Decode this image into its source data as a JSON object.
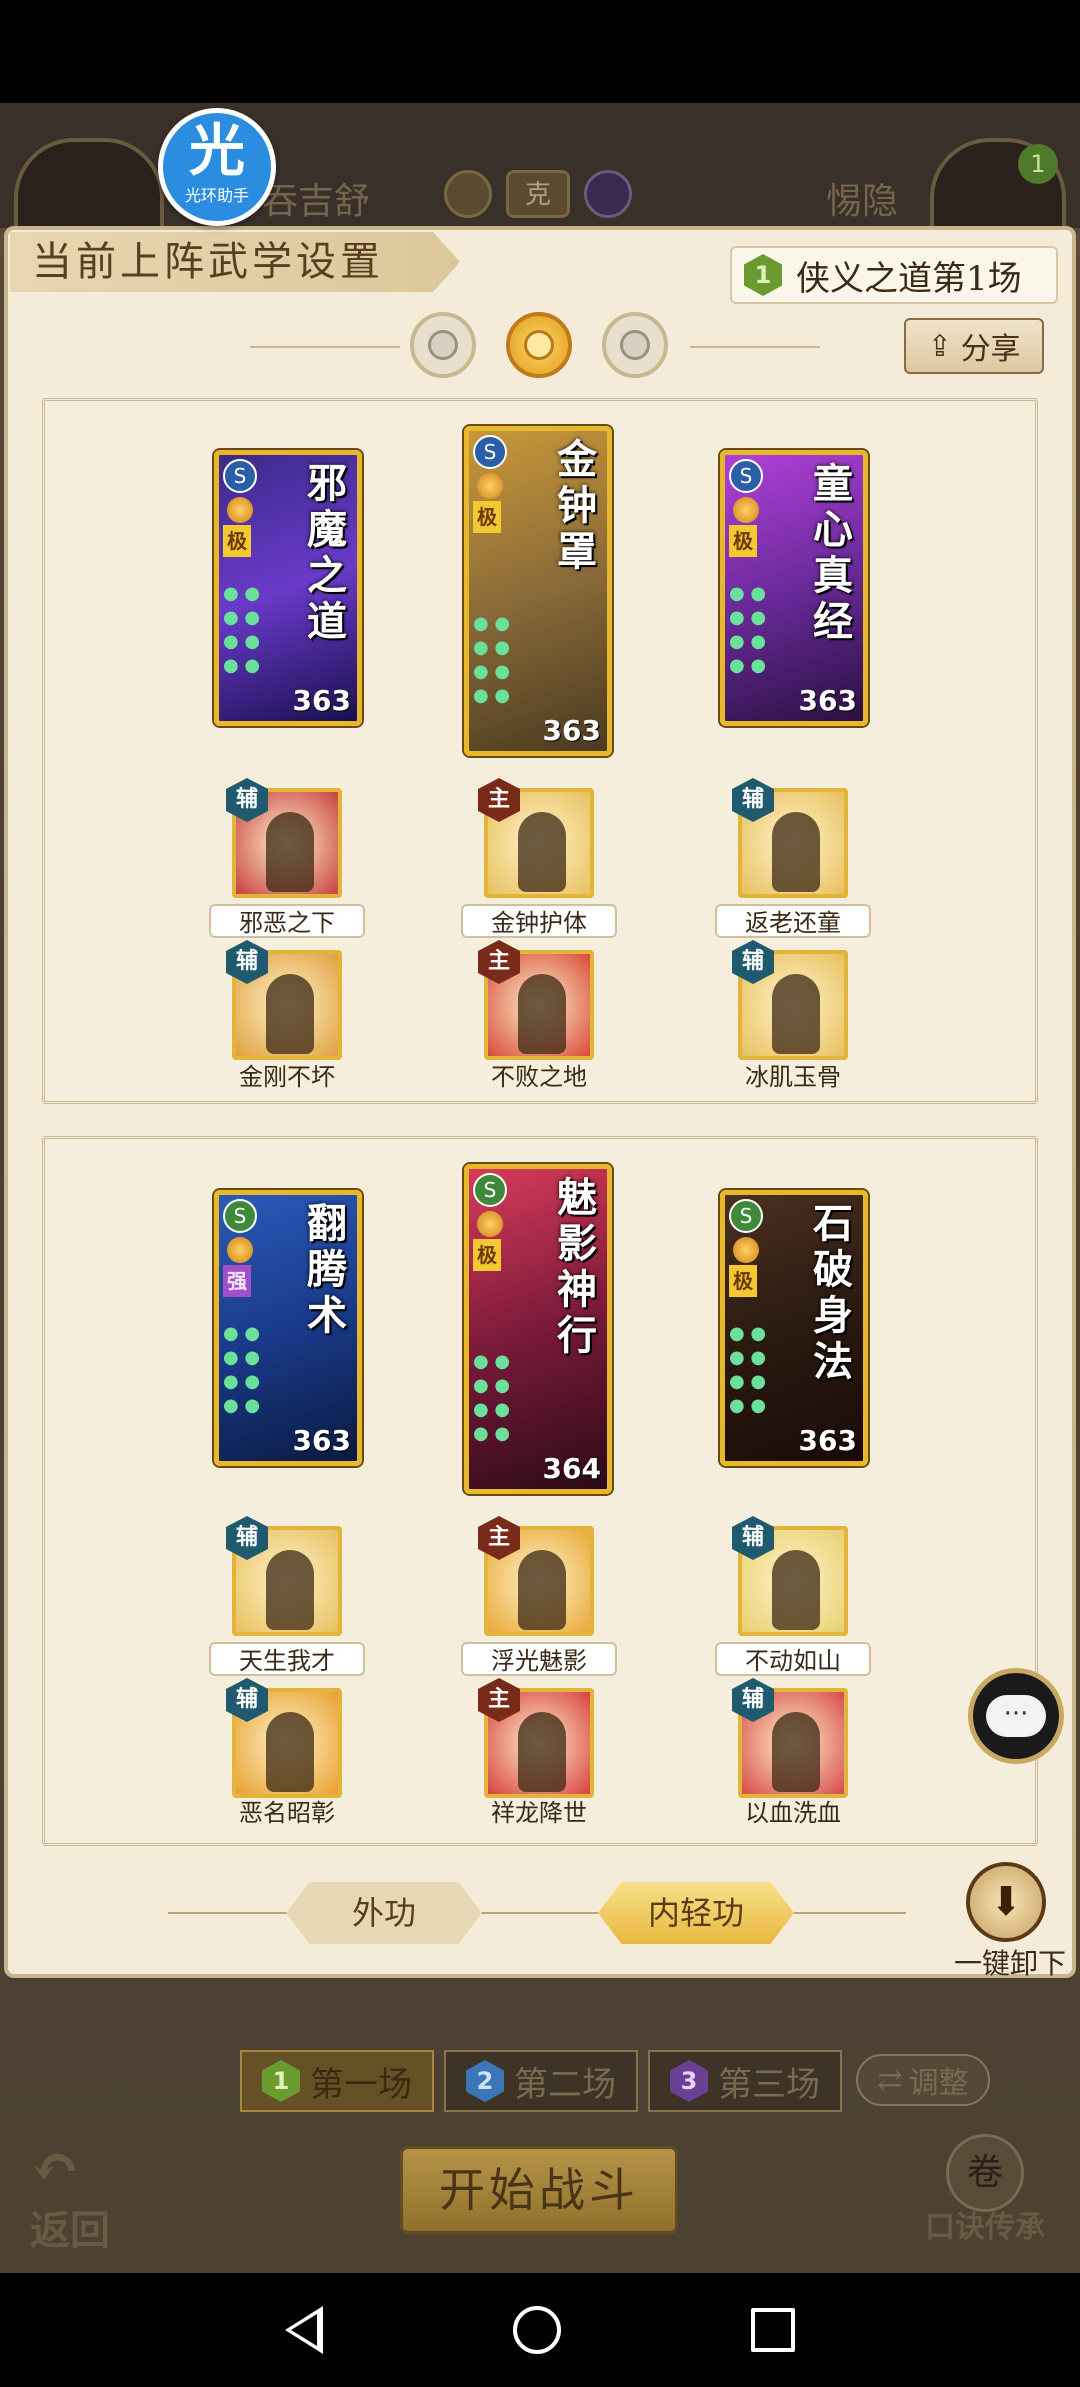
{
  "header": {
    "player_left": "吞吉舒",
    "player_right": "惕隐",
    "player_right_level": "1",
    "vs_label": "克",
    "helper_logo_big": "光",
    "helper_logo_small": "光环助手"
  },
  "panel": {
    "title": "当前上阵武学设置",
    "battle_badge": "1",
    "battle_label": "侠义之道第1场",
    "share_label": "分享",
    "share_icon": "share-icon"
  },
  "section1": {
    "cards": [
      {
        "title": "邪魔之道",
        "grade": "极",
        "power": "363",
        "badge": "S",
        "bg": [
          "#3a2a8a",
          "#6a3ac8",
          "#1a1050"
        ]
      },
      {
        "title": "金钟罩",
        "grade": "极",
        "power": "363",
        "badge": "S",
        "bg": [
          "#c89838",
          "#8a6a38",
          "#4a3a20"
        ]
      },
      {
        "title": "童心真经",
        "grade": "极",
        "power": "363",
        "badge": "S",
        "bg": [
          "#b040d8",
          "#6a2a9a",
          "#2a1040"
        ]
      }
    ],
    "skills_row1": [
      {
        "tag": "辅",
        "label": "邪恶之下",
        "bg": "#c84040"
      },
      {
        "tag": "主",
        "label": "金钟护体",
        "bg": "#e8c060"
      },
      {
        "tag": "辅",
        "label": "返老还童",
        "bg": "#e8c060"
      }
    ],
    "skills_row2": [
      {
        "tag": "辅",
        "label": "金刚不坏",
        "bg": "#e0a040"
      },
      {
        "tag": "主",
        "label": "不败之地",
        "bg": "#d84a3a"
      },
      {
        "tag": "辅",
        "label": "冰肌玉骨",
        "bg": "#e8c060"
      }
    ]
  },
  "section2": {
    "cards": [
      {
        "title": "翻腾术",
        "grade": "强",
        "power": "363",
        "badge": "S",
        "bg": [
          "#2a5ab8",
          "#1a3a8a",
          "#0a1a40"
        ]
      },
      {
        "title": "魅影神行",
        "grade": "极",
        "power": "364",
        "badge": "S",
        "bg": [
          "#d83a5a",
          "#7a1a3a",
          "#2a0a18"
        ]
      },
      {
        "title": "石破身法",
        "grade": "极",
        "power": "363",
        "badge": "S",
        "bg": [
          "#4a3020",
          "#2a1a10",
          "#1a0a08"
        ]
      }
    ],
    "skills_row1": [
      {
        "tag": "辅",
        "label": "天生我才",
        "bg": "#e8c060"
      },
      {
        "tag": "主",
        "label": "浮光魅影",
        "bg": "#e8a838"
      },
      {
        "tag": "辅",
        "label": "不动如山",
        "bg": "#e8d070"
      }
    ],
    "skills_row2": [
      {
        "tag": "辅",
        "label": "恶名昭彰",
        "bg": "#e8a030"
      },
      {
        "tag": "主",
        "label": "祥龙降世",
        "bg": "#d84040"
      },
      {
        "tag": "辅",
        "label": "以血洗血",
        "bg": "#d84a4a"
      }
    ]
  },
  "footer_tabs": {
    "outer": "外功",
    "inner": "内轻功",
    "unload": "一键卸下"
  },
  "chat": {
    "icon": "chat-icon",
    "glyph": "···"
  },
  "rounds": [
    {
      "badge": "1",
      "label": "第一场"
    },
    {
      "badge": "2",
      "label": "第二场"
    },
    {
      "badge": "3",
      "label": "第三场"
    }
  ],
  "adjust_label": "调整",
  "start_label": "开始战斗",
  "back_label": "返回",
  "inherit_label": "口诀传承"
}
